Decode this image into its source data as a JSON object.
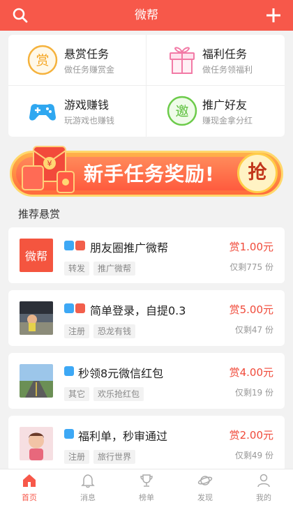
{
  "header": {
    "title": "微帮",
    "search_icon": "search-icon",
    "add_icon": "plus-icon",
    "bg_color": "#f7584a"
  },
  "categories": [
    {
      "title": "悬赏任务",
      "subtitle": "做任务赚赏金",
      "icon": "bounty-coin-icon",
      "icon_char": "赏"
    },
    {
      "title": "福利任务",
      "subtitle": "做任务领福利",
      "icon": "gift-box-icon"
    },
    {
      "title": "游戏赚钱",
      "subtitle": "玩游戏也赚钱",
      "icon": "gamepad-icon"
    },
    {
      "title": "推广好友",
      "subtitle": "赚现金拿分红",
      "icon": "invite-icon",
      "icon_char": "邀"
    }
  ],
  "banner": {
    "text": "新手任务奖励!",
    "button_char": "抢",
    "envelope_char": "¥"
  },
  "section": {
    "title": "推荐悬赏"
  },
  "tasks": [
    {
      "name": "朋友圈推广微帮",
      "tags": [
        "转发",
        "推广微帮"
      ],
      "reward": "赏1.00元",
      "remaining": "仅剩775 份",
      "badges": [
        "star",
        "up"
      ],
      "thumb_text": "微帮"
    },
    {
      "name": "简单登录，自提0.3",
      "tags": [
        "注册",
        "恐龙有钱"
      ],
      "reward": "赏5.00元",
      "remaining": "仅剩47 份",
      "badges": [
        "star",
        "up"
      ]
    },
    {
      "name": "秒领8元微信红包",
      "tags": [
        "其它",
        "欢乐抢红包"
      ],
      "reward": "赏4.00元",
      "remaining": "仅剩19 份",
      "badges": [
        "star"
      ]
    },
    {
      "name": "福利单，秒审通过",
      "tags": [
        "注册",
        "旅行世界"
      ],
      "reward": "赏2.00元",
      "remaining": "仅剩49 份",
      "badges": [
        "star"
      ]
    }
  ],
  "tabbar": [
    {
      "label": "首页",
      "icon": "home-icon",
      "active": true
    },
    {
      "label": "消息",
      "icon": "bell-icon",
      "active": false
    },
    {
      "label": "榜单",
      "icon": "trophy-icon",
      "active": false
    },
    {
      "label": "发现",
      "icon": "planet-icon",
      "active": false
    },
    {
      "label": "我的",
      "icon": "user-icon",
      "active": false
    }
  ],
  "accent_color": "#f04a3a"
}
